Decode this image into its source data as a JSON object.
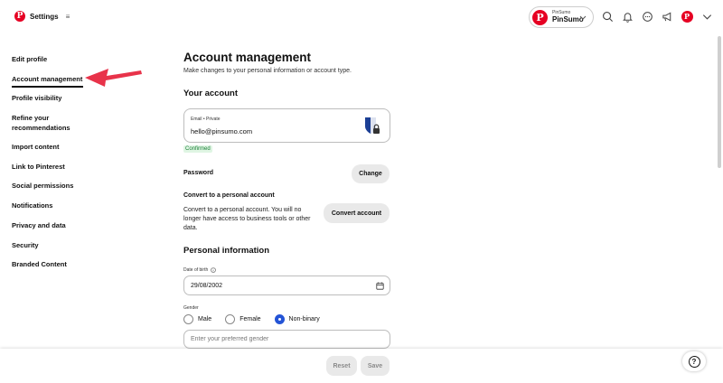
{
  "header": {
    "title": "Settings",
    "account_small": "PinSumo",
    "account_name": "PinSumo"
  },
  "sidebar": {
    "items": [
      {
        "label": "Edit profile"
      },
      {
        "label": "Account management"
      },
      {
        "label": "Profile visibility"
      },
      {
        "label": "Refine your recommendations"
      },
      {
        "label": "Import content"
      },
      {
        "label": "Link to Pinterest"
      },
      {
        "label": "Social permissions"
      },
      {
        "label": "Notifications"
      },
      {
        "label": "Privacy and data"
      },
      {
        "label": "Security"
      },
      {
        "label": "Branded Content"
      }
    ],
    "active_index": 1
  },
  "main": {
    "title": "Account management",
    "subtitle": "Make changes to your personal information or account type.",
    "your_account": {
      "heading": "Your account",
      "email_label": "Email • Private",
      "email_value": "hello@pinsumo.com",
      "confirmed": "Confirmed",
      "password_label": "Password",
      "change_button": "Change",
      "convert_heading": "Convert to a personal account",
      "convert_desc": "Convert to a personal account. You will no longer have access to business tools or other data.",
      "convert_button": "Convert account"
    },
    "personal": {
      "heading": "Personal information",
      "dob_label": "Date of birth",
      "dob_value": "29/08/2002",
      "gender_label": "Gender",
      "gender_options": [
        "Male",
        "Female",
        "Non-binary"
      ],
      "gender_selected": "Non-binary",
      "gender_placeholder": "Enter your preferred gender"
    }
  },
  "footer": {
    "reset": "Reset",
    "save": "Save"
  },
  "colors": {
    "brand": "#e60023",
    "annotation_arrow": "#e8334a",
    "radio_selected": "#2454d6",
    "confirmed": "#1a7f37"
  },
  "icons": [
    "pinterest-logo-icon",
    "menu-icon",
    "chevron-down-icon",
    "search-icon",
    "bell-icon",
    "messages-icon",
    "megaphone-icon",
    "shield-lock-icon",
    "info-icon",
    "calendar-icon",
    "help-icon"
  ]
}
